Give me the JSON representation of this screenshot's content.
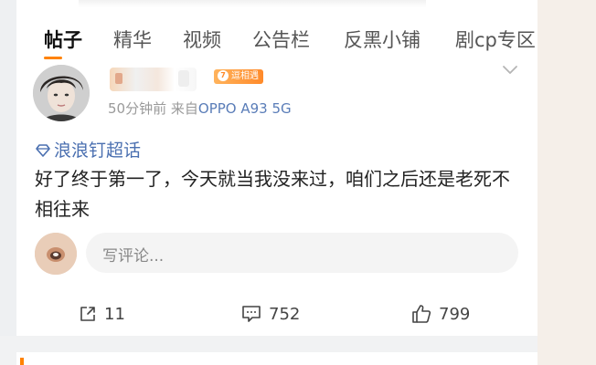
{
  "tabs": [
    {
      "label": "帖子",
      "active": true
    },
    {
      "label": "精华"
    },
    {
      "label": "视频"
    },
    {
      "label": "公告栏"
    },
    {
      "label": "反黑小铺"
    },
    {
      "label": "剧cp专区"
    }
  ],
  "colors": {
    "accent": "#ff8200",
    "link": "#4a6fb0",
    "meta": "#9a9a9a"
  },
  "post": {
    "badge": {
      "level": "7",
      "text": "逗相遇"
    },
    "time": "50分钟前",
    "source_prefix": "来自",
    "device": "OPPO A93 5G",
    "topic": "浪浪钉超话",
    "text": "好了终于第一了，今天就当我没来过，咱们之后还是老死不相往来"
  },
  "comment_box": {
    "placeholder": "写评论..."
  },
  "actions": {
    "share_count": "11",
    "comment_count": "752",
    "like_count": "799"
  },
  "icons": [
    "chevron-down-icon",
    "diamond-topic-icon",
    "share-icon",
    "comment-icon",
    "thumbs-up-icon"
  ]
}
